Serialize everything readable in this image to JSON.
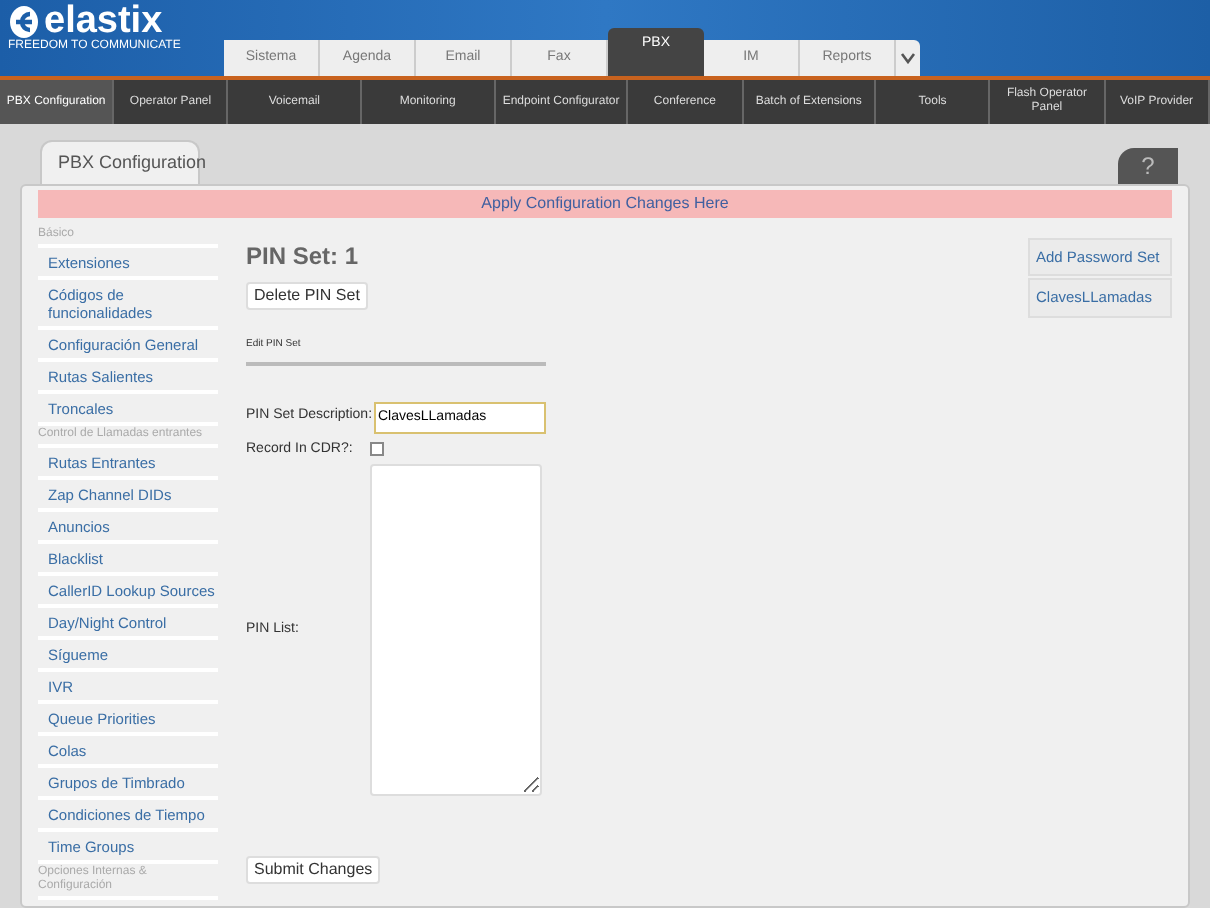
{
  "logo": {
    "name": "elastix",
    "tagline": "FREEDOM TO COMMUNICATE"
  },
  "main_tabs": [
    {
      "label": "Sistema",
      "selected": false
    },
    {
      "label": "Agenda",
      "selected": false
    },
    {
      "label": "Email",
      "selected": false
    },
    {
      "label": "Fax",
      "selected": false
    },
    {
      "label": "PBX",
      "selected": true
    },
    {
      "label": "IM",
      "selected": false
    },
    {
      "label": "Reports",
      "selected": false
    }
  ],
  "sub_tabs": [
    {
      "label": "PBX Configuration",
      "selected": true
    },
    {
      "label": "Operator Panel",
      "selected": false
    },
    {
      "label": "Voicemail",
      "selected": false
    },
    {
      "label": "Monitoring",
      "selected": false
    },
    {
      "label": "Endpoint Configurator",
      "selected": false
    },
    {
      "label": "Conference",
      "selected": false
    },
    {
      "label": "Batch of Extensions",
      "selected": false
    },
    {
      "label": "Tools",
      "selected": false
    },
    {
      "label": "Flash Operator Panel",
      "selected": false
    },
    {
      "label": "VoIP Provider",
      "selected": false
    }
  ],
  "panel_tab": "PBX Configuration",
  "help": "?",
  "apply_link": "Apply Configuration Changes Here",
  "sidebar": [
    {
      "kind": "header",
      "label": "Básico"
    },
    {
      "kind": "link",
      "label": "Extensiones"
    },
    {
      "kind": "link",
      "label": "Códigos de funcionalidades"
    },
    {
      "kind": "link",
      "label": "Configuración General"
    },
    {
      "kind": "link",
      "label": "Rutas Salientes"
    },
    {
      "kind": "link",
      "label": "Troncales"
    },
    {
      "kind": "header",
      "label": "Control de Llamadas entrantes"
    },
    {
      "kind": "link",
      "label": "Rutas Entrantes"
    },
    {
      "kind": "link",
      "label": "Zap Channel DIDs"
    },
    {
      "kind": "link",
      "label": "Anuncios"
    },
    {
      "kind": "link",
      "label": "Blacklist"
    },
    {
      "kind": "link",
      "label": "CallerID Lookup Sources"
    },
    {
      "kind": "link",
      "label": "Day/Night Control"
    },
    {
      "kind": "link",
      "label": "Sígueme"
    },
    {
      "kind": "link",
      "label": "IVR"
    },
    {
      "kind": "link",
      "label": "Queue Priorities"
    },
    {
      "kind": "link",
      "label": "Colas"
    },
    {
      "kind": "link",
      "label": "Grupos de Timbrado"
    },
    {
      "kind": "link",
      "label": "Condiciones de Tiempo"
    },
    {
      "kind": "link",
      "label": "Time Groups"
    },
    {
      "kind": "header",
      "label": "Opciones Internas & Configuración"
    }
  ],
  "heading": "PIN Set: 1",
  "delete_button": "Delete PIN Set",
  "section": "Edit PIN Set",
  "form": {
    "description_label": "PIN Set Description:",
    "description_value": "ClavesLLamadas",
    "record_label": "Record In CDR?:",
    "record_checked": false,
    "pin_list_label": "PIN List:"
  },
  "submit_button": "Submit Changes",
  "right_links": [
    "Add Password Set",
    "ClavesLLamadas"
  ]
}
